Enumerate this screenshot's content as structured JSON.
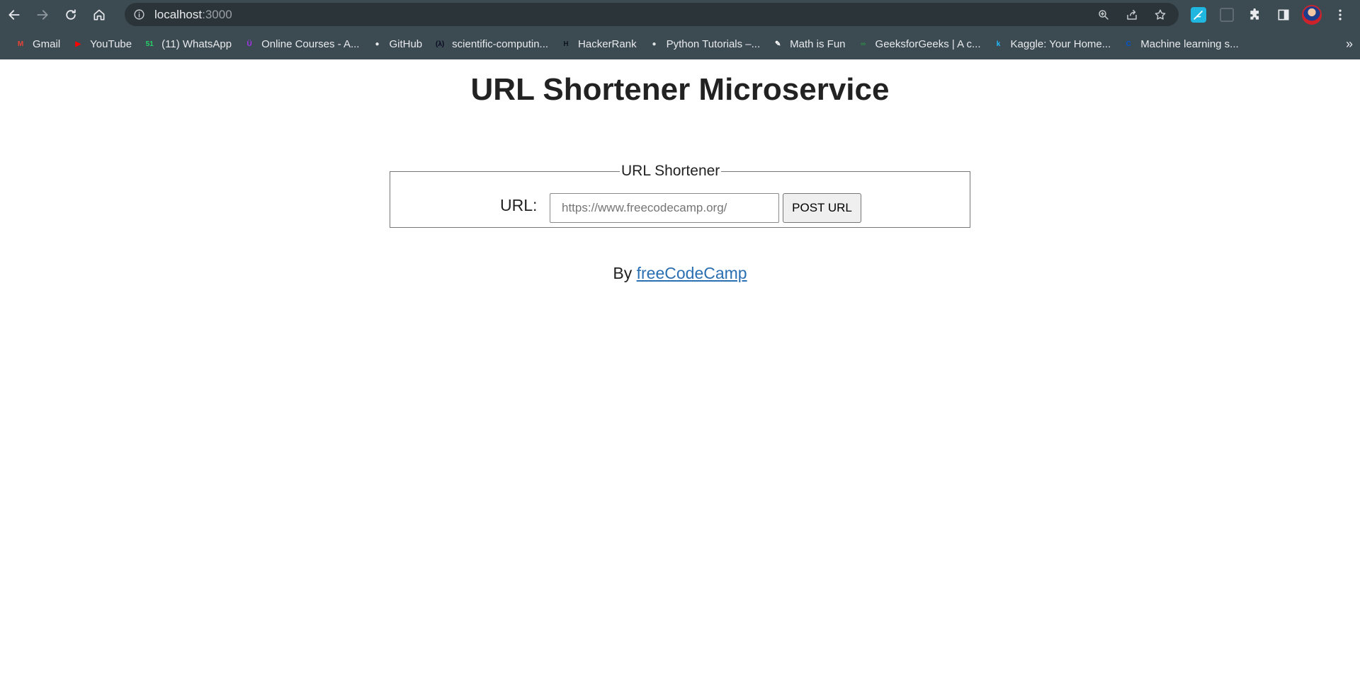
{
  "browser": {
    "address": {
      "host": "localhost",
      "port": ":3000"
    },
    "bookmarks": [
      {
        "label": "Gmail",
        "icon": "gmail-icon",
        "color": "#ea4335",
        "glyph": "M"
      },
      {
        "label": "YouTube",
        "icon": "youtube-icon",
        "color": "#ff0000",
        "glyph": "▶"
      },
      {
        "label": "(11) WhatsApp",
        "icon": "whatsapp-icon",
        "color": "#25d366",
        "glyph": "51"
      },
      {
        "label": "Online Courses - A...",
        "icon": "udemy-icon",
        "color": "#a435f0",
        "glyph": "Ü"
      },
      {
        "label": "GitHub",
        "icon": "github-icon",
        "color": "#e8eaed",
        "glyph": "●"
      },
      {
        "label": "scientific-computin...",
        "icon": "freecodecamp-icon",
        "color": "#0a0a23",
        "glyph": "(λ)"
      },
      {
        "label": "HackerRank",
        "icon": "hackerrank-icon",
        "color": "#0e141e",
        "glyph": "H"
      },
      {
        "label": "Python Tutorials –...",
        "icon": "python-icon",
        "color": "#dfe3e6",
        "glyph": "●"
      },
      {
        "label": "Math is Fun",
        "icon": "mathisfun-icon",
        "color": "#ffffff",
        "glyph": "✎"
      },
      {
        "label": "GeeksforGeeks | A c...",
        "icon": "geeksforgeeks-icon",
        "color": "#2f8d46",
        "glyph": "∞"
      },
      {
        "label": "Kaggle: Your Home...",
        "icon": "kaggle-icon",
        "color": "#20beff",
        "glyph": "k"
      },
      {
        "label": "Machine learning s...",
        "icon": "coursera-icon",
        "color": "#0056d2",
        "glyph": "C"
      }
    ],
    "more_label": "»"
  },
  "page": {
    "title": "URL Shortener Microservice",
    "form": {
      "legend": "URL Shortener",
      "url_label": "URL:",
      "url_placeholder": "https://www.freecodecamp.org/",
      "submit_label": "POST URL"
    },
    "byline": {
      "prefix": "By",
      "link_text": "freeCodeCamp"
    },
    "colors": {
      "link": "#2a6fb2",
      "chrome": "#3c4a52"
    }
  }
}
